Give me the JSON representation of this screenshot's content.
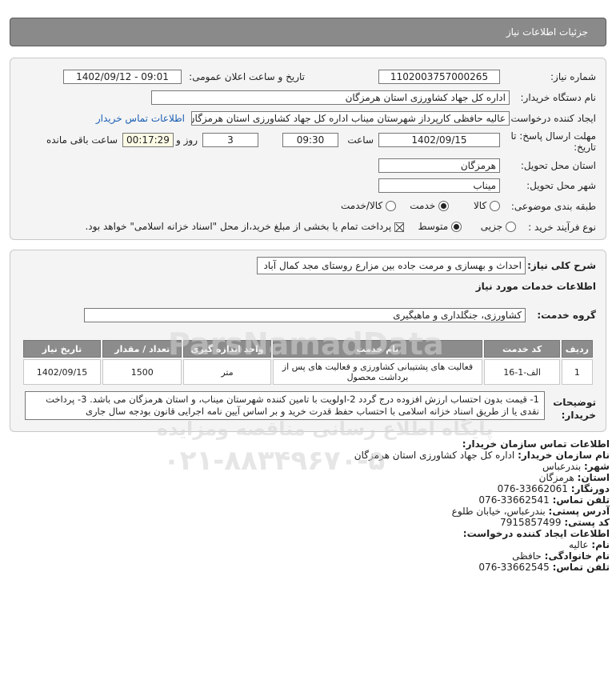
{
  "title": "جزئیات اطلاعات نیاز",
  "fields": {
    "need_number_label": "شماره نیاز:",
    "need_number": "1102003757000265",
    "announce_label": "تاریخ و ساعت اعلان عمومی:",
    "announce_value": "1402/09/12 - 09:01",
    "buyer_org_label": "نام دستگاه خریدار:",
    "buyer_org": "اداره کل جهاد کشاورزی استان هرمزگان",
    "creator_label": "ایجاد کننده درخواست:",
    "creator": "عالیه حافظی کارپرداز شهرستان میناب اداره کل جهاد کشاورزی استان هرمزگان",
    "contact_link": "اطلاعات تماس خریدار",
    "deadline_label_1": "مهلت ارسال پاسخ: تا",
    "deadline_label_2": "تاریخ:",
    "deadline_date": "1402/09/15",
    "time_label": "ساعت",
    "deadline_time": "09:30",
    "days_value": "3",
    "days_label": "روز و",
    "remaining": "00:17:29",
    "remaining_label": "ساعت باقی مانده",
    "province_label": "استان محل تحویل:",
    "province": "هرمزگان",
    "city_label": "شهر محل تحویل:",
    "city": "میناب",
    "category_label": "طبقه بندی موضوعی:",
    "category_options": [
      "کالا",
      "خدمت",
      "کالا/خدمت"
    ],
    "process_label": "نوع فرآیند خرید :",
    "process_options": [
      "جزیی",
      "متوسط"
    ],
    "payment_note": "پرداخت تمام یا بخشی از مبلغ خرید،از محل \"اسناد خزانه اسلامی\" خواهد بود."
  },
  "need": {
    "summary_label": "شرح کلی نیاز:",
    "summary": "احداث و بهسازی و مرمت جاده بین مزارع روستای مجد کمال آباد",
    "services_title": "اطلاعات خدمات مورد نیاز",
    "group_label": "گروه خدمت:",
    "group": "کشاورزی، جنگلداری و ماهیگیری"
  },
  "table": {
    "headers": [
      "ردیف",
      "کد خدمت",
      "نام خدمت",
      "واحد اندازه گیری",
      "تعداد / مقدار",
      "تاریخ نیاز"
    ],
    "rows": [
      [
        "1",
        "الف-1-16",
        "فعالیت های پشتیبانی کشاورزی و فعالیت های پس از برداشت محصول",
        "متر",
        "1500",
        "1402/09/15"
      ]
    ]
  },
  "notes": {
    "label": "توضیحات خریدار:",
    "text": "1- قیمت بدون احتساب ارزش افزوده درج گردد 2-اولویت با تامین کننده شهرستان میناب، و استان هرمزگان می باشد. 3- پرداخت نقدی یا از طریق اسناد خزانه اسلامی با احتساب حفظ قدرت خرید و بر اساس آیین نامه اجرایی قانون بودجه سال جاری"
  },
  "contact": {
    "header": "اطلاعات تماس سازمان خریدار:",
    "org_label": "نام سازمان خریدار:",
    "org": "اداره کل جهاد کشاورزی استان هرمزگان",
    "city_label": "شهر:",
    "city": "بندرعباس",
    "province_label": "استان:",
    "province": "هرمزگان",
    "fax_label": "دورنگار:",
    "fax": "076-33662061",
    "phone_label": "تلفن تماس:",
    "phone": "076-33662541",
    "address_label": "آدرس پستی:",
    "address": "بندرعباس، خیابان طلوع",
    "postal_label": "کد پستی:",
    "postal": "7915857499",
    "creator_header": "اطلاعات ایجاد کننده درخواست:",
    "first_name_label": "نام:",
    "first_name": "عالیه",
    "last_name_label": "نام خانوادگی:",
    "last_name": "حافظی",
    "creator_phone_label": "تلفن تماس:",
    "creator_phone": "076-33662545"
  },
  "watermark": {
    "brand": "ParsNamadData",
    "line": "پایگاه اطلاع رسانی مناقصه ومزایده",
    "phone": "۰۲۱-۸۸۳۴۹۶۷۰-۵"
  }
}
